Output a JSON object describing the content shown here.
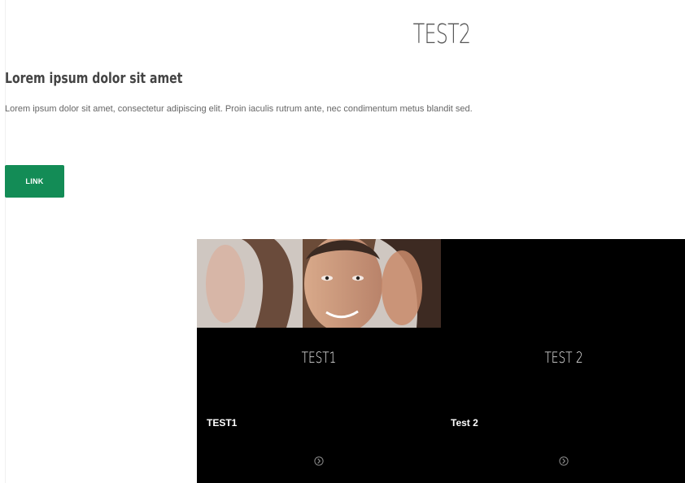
{
  "header": {
    "title": "TEST2"
  },
  "content": {
    "heading": "Lorem ipsum dolor sit amet",
    "body": "Lorem ipsum dolor sit amet, consectetur adipiscing elit. Proin iaculis rutrum ante, nec condimentum metus blandit sed.",
    "link_label": "LINK"
  },
  "cards": [
    {
      "title": "TEST1",
      "subtitle": "TEST1",
      "has_image": true,
      "arrow_icon": "chevron-right-circle-icon"
    },
    {
      "title": "TEST 2",
      "subtitle": "Test 2",
      "has_image": false,
      "arrow_icon": "chevron-right-circle-icon"
    }
  ],
  "colors": {
    "button": "#138c56",
    "card_background": "#000000",
    "heading": "#444444",
    "body_text": "#666666"
  }
}
